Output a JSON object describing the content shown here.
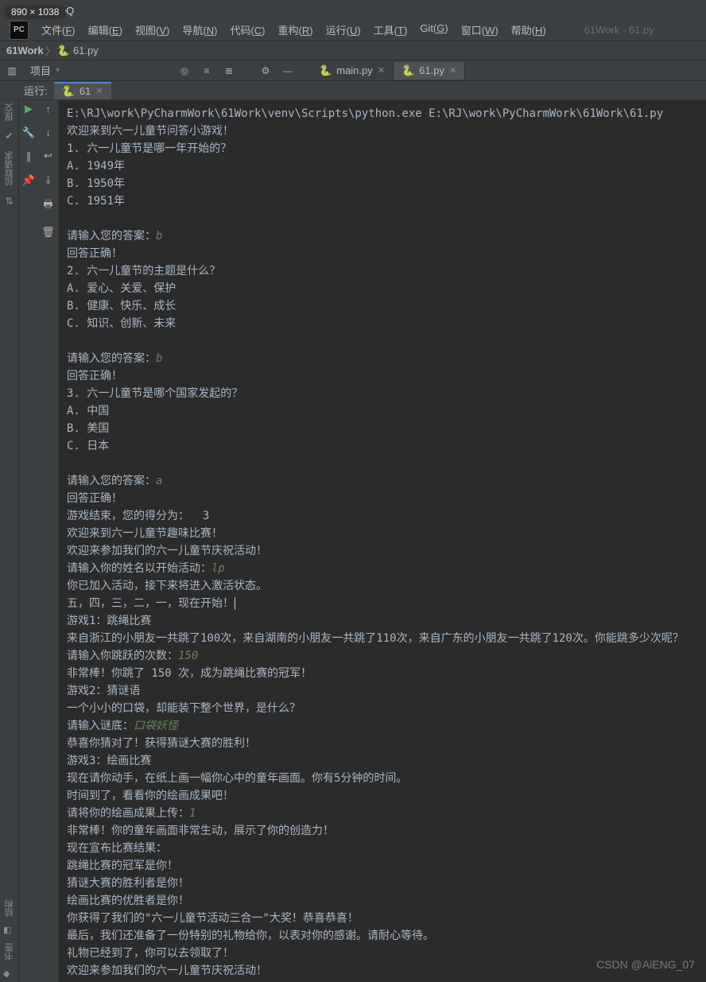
{
  "badge": "890 × 1038",
  "titlebar": "讯QQ",
  "menu": [
    "文件(F)",
    "编辑(E)",
    "视图(V)",
    "导航(N)",
    "代码(C)",
    "重构(R)",
    "运行(U)",
    "工具(T)",
    "Git(G)",
    "窗口(W)",
    "帮助(H)"
  ],
  "project_label": "61Work - 61.py",
  "breadcrumb": {
    "project": "61Work",
    "file": "61.py"
  },
  "toolbar": {
    "project_dropdown": "项目"
  },
  "tabs": [
    {
      "name": "main.py",
      "active": false
    },
    {
      "name": "61.py",
      "active": true
    }
  ],
  "run": {
    "label": "运行:",
    "config": "61"
  },
  "side_labels": [
    "提交",
    "拉取请求"
  ],
  "bottom_labels": [
    "结构",
    "书签"
  ],
  "csdn": "CSDN @AiENG_07",
  "console": [
    {
      "t": "E:\\RJ\\work\\PyCharmWork\\61Work\\venv\\Scripts\\python.exe E:\\RJ\\work\\PyCharmWork\\61Work\\61.py"
    },
    {
      "t": "欢迎来到六一儿童节问答小游戏！"
    },
    {
      "t": "1. 六一儿童节是哪一年开始的？"
    },
    {
      "t": "A. 1949年"
    },
    {
      "t": "B. 1950年"
    },
    {
      "t": "C. 1951年"
    },
    {
      "t": ""
    },
    {
      "prompt": "请输入您的答案：",
      "input": "b"
    },
    {
      "t": "回答正确！"
    },
    {
      "t": "2. 六一儿童节的主题是什么？"
    },
    {
      "t": "A. 爱心、关爱、保护"
    },
    {
      "t": "B. 健康、快乐、成长"
    },
    {
      "t": "C. 知识、创新、未来"
    },
    {
      "t": ""
    },
    {
      "prompt": "请输入您的答案：",
      "input": "b"
    },
    {
      "t": "回答正确！"
    },
    {
      "t": "3. 六一儿童节是哪个国家发起的？"
    },
    {
      "t": "A. 中国"
    },
    {
      "t": "B. 美国"
    },
    {
      "t": "C. 日本"
    },
    {
      "t": ""
    },
    {
      "prompt": "请输入您的答案：",
      "input": "a"
    },
    {
      "t": "回答正确！"
    },
    {
      "t": "游戏结束，您的得分为：  3"
    },
    {
      "t": "欢迎来到六一儿童节趣味比赛！"
    },
    {
      "t": "欢迎来参加我们的六一儿童节庆祝活动！"
    },
    {
      "prompt": "请输入你的姓名以开始活动：",
      "input": "lp"
    },
    {
      "t": "你已加入活动，接下来将进入激活状态。"
    },
    {
      "t": "五，四，三，二，一，现在开始！",
      "cursor": true
    },
    {
      "t": "游戏1：跳绳比赛"
    },
    {
      "t": "来自浙江的小朋友一共跳了100次，来自湖南的小朋友一共跳了110次，来自广东的小朋友一共跳了120次。你能跳多少次呢？"
    },
    {
      "prompt": "请输入你跳跃的次数：",
      "input": "150"
    },
    {
      "t": "非常棒！你跳了 150 次，成为跳绳比赛的冠军！"
    },
    {
      "t": "游戏2：猜谜语"
    },
    {
      "t": "一个小小的口袋，却能装下整个世界，是什么？"
    },
    {
      "prompt": "请输入谜底：",
      "input": "口袋妖怪"
    },
    {
      "t": "恭喜你猜对了！获得猜谜大赛的胜利！"
    },
    {
      "t": "游戏3：绘画比赛"
    },
    {
      "t": "现在请你动手，在纸上画一幅你心中的童年画面。你有5分钟的时间。"
    },
    {
      "t": "时间到了，看看你的绘画成果吧！"
    },
    {
      "prompt": "请将你的绘画成果上传：",
      "input": "1"
    },
    {
      "t": "非常棒！你的童年画面非常生动，展示了你的创造力！"
    },
    {
      "t": "现在宣布比赛结果："
    },
    {
      "t": "跳绳比赛的冠军是你！"
    },
    {
      "t": "猜谜大赛的胜利者是你！"
    },
    {
      "t": "绘画比赛的优胜者是你！"
    },
    {
      "t": "你获得了我们的\"六一儿童节活动三合一\"大奖！恭喜恭喜！"
    },
    {
      "t": "最后，我们还准备了一份特别的礼物给你，以表对你的感谢。请耐心等待。"
    },
    {
      "t": "礼物已经到了，你可以去领取了！"
    },
    {
      "t": "欢迎来参加我们的六一儿童节庆祝活动！"
    }
  ]
}
